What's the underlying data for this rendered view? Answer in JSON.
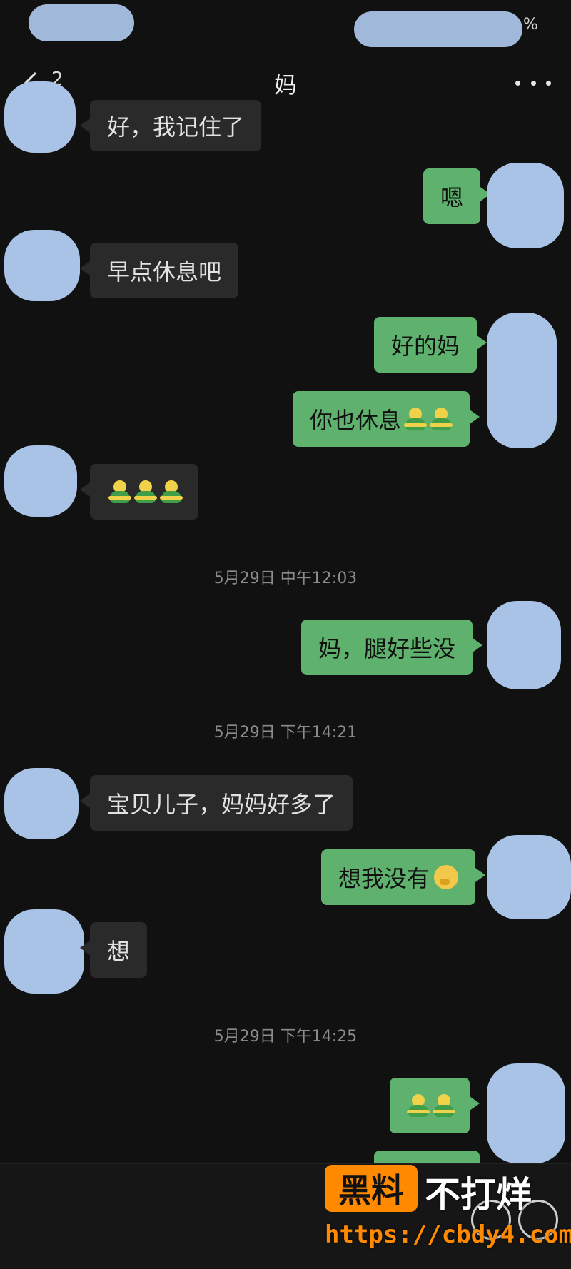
{
  "status": {
    "battery_text": "%"
  },
  "header": {
    "unread_count": "2",
    "title": "妈"
  },
  "icons": {
    "back": "chevron-left-icon",
    "more": "more-dots-icon"
  },
  "messages": [
    {
      "from": "mom",
      "text": "好，我记住了"
    },
    {
      "from": "me",
      "text": "嗯"
    },
    {
      "from": "mom",
      "text": "早点休息吧"
    },
    {
      "from": "me",
      "text": "好的妈"
    },
    {
      "from": "me",
      "text": "你也休息",
      "emoji": [
        "hug-emoji",
        "hug-emoji"
      ]
    },
    {
      "from": "mom",
      "text": "",
      "emoji": [
        "hug-emoji",
        "hug-emoji",
        "hug-emoji"
      ]
    },
    {
      "type": "timestamp",
      "text": "5月29日 中午12:03"
    },
    {
      "from": "me",
      "text": "妈，腿好些没"
    },
    {
      "type": "timestamp",
      "text": "5月29日 下午14:21"
    },
    {
      "from": "mom",
      "text": "宝贝儿子，妈妈好多了"
    },
    {
      "from": "me",
      "text": "想我没有",
      "emoji": [
        "thinking-emoji"
      ]
    },
    {
      "from": "mom",
      "text": "想"
    },
    {
      "type": "timestamp",
      "text": "5月29日 下午14:25"
    },
    {
      "from": "me",
      "text": "",
      "emoji": [
        "hug-emoji",
        "hug-emoji"
      ]
    }
  ],
  "watermark": {
    "box_text": "黑料",
    "text": "不打烊",
    "url": "https://cbdy4.com"
  },
  "colors": {
    "background": "#111111",
    "incoming_bubble": "#2a2a2a",
    "outgoing_bubble": "#5fb26e",
    "watermark": "#ff8a00"
  }
}
